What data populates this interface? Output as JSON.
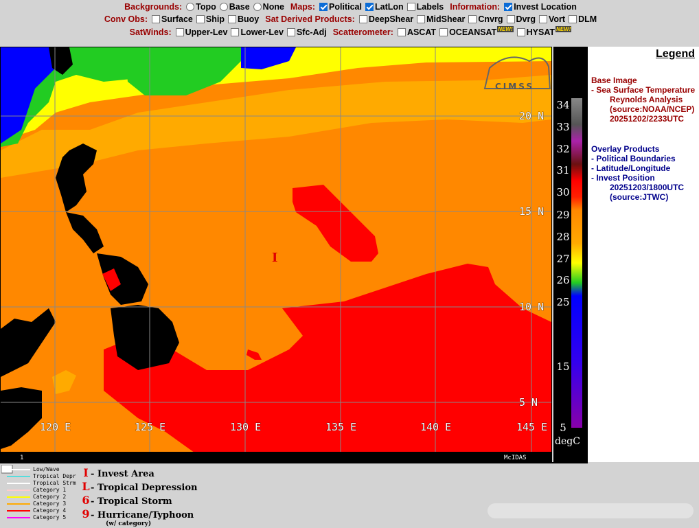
{
  "controls": {
    "backgrounds": {
      "label": "Backgrounds:",
      "options": [
        {
          "label": "Topo",
          "checked": false
        },
        {
          "label": "Base",
          "checked": false
        },
        {
          "label": "None",
          "checked": false
        }
      ]
    },
    "maps": {
      "label": "Maps:",
      "options": [
        {
          "label": "Political",
          "checked": true
        },
        {
          "label": "LatLon",
          "checked": true
        },
        {
          "label": "Labels",
          "checked": false
        }
      ]
    },
    "information": {
      "label": "Information:",
      "options": [
        {
          "label": "Invest Location",
          "checked": true
        }
      ]
    },
    "conv_obs": {
      "label": "Conv Obs:",
      "options": [
        {
          "label": "Surface",
          "checked": false
        },
        {
          "label": "Ship",
          "checked": false
        },
        {
          "label": "Buoy",
          "checked": false
        }
      ]
    },
    "sat_derived": {
      "label": "Sat Derived Products:",
      "options": [
        {
          "label": "DeepShear",
          "checked": false
        },
        {
          "label": "MidShear",
          "checked": false
        },
        {
          "label": "Cnvrg",
          "checked": false
        },
        {
          "label": "Dvrg",
          "checked": false
        },
        {
          "label": "Vort",
          "checked": false
        },
        {
          "label": "DLM",
          "checked": false
        }
      ]
    },
    "satwinds": {
      "label": "SatWinds:",
      "options": [
        {
          "label": "Upper-Lev",
          "checked": false
        },
        {
          "label": "Lower-Lev",
          "checked": false
        },
        {
          "label": "Sfc-Adj",
          "checked": false
        }
      ]
    },
    "scatterometer": {
      "label": "Scatterometer:",
      "options": [
        {
          "label": "ASCAT",
          "checked": false,
          "new": ""
        },
        {
          "label": "OCEANSAT",
          "checked": false,
          "new": "NEW!"
        },
        {
          "label": "HYSAT",
          "checked": false,
          "new": "NEW!"
        }
      ]
    }
  },
  "map": {
    "logo_text": "CIMSS",
    "footer_left": "1",
    "footer_right": "McIDAS",
    "invest_marker": "I",
    "lat_labels": [
      "20 N",
      "15 N",
      "10 N",
      "5 N"
    ],
    "lon_labels": [
      "120 E",
      "125 E",
      "130 E",
      "135 E",
      "140 E",
      "145 E"
    ],
    "sst_colors": {
      "green": "#22cc22",
      "yellow": "#ffff00",
      "light_orange": "#ffaa00",
      "orange": "#ff8800",
      "red": "#ff0000",
      "dark_red": "#aa1111",
      "blue": "#0000ff",
      "land": "#000000"
    }
  },
  "colorbar": {
    "labels": [
      "34",
      "33",
      "32",
      "31",
      "30",
      "29",
      "28",
      "27",
      "26",
      "25",
      "15",
      "5"
    ],
    "unit": "degC"
  },
  "legend": {
    "title": "Legend",
    "base_image_heading": "Base Image",
    "base_image_item": "- Sea Surface Temperature",
    "base_image_sub": [
      "Reynolds Analysis",
      "(source:NOAA/NCEP)",
      "20251202/2233UTC"
    ],
    "overlay_heading": "Overlay Products",
    "overlay_items": [
      "- Political Boundaries",
      "- Latitude/Longitude",
      "- Invest Position"
    ],
    "overlay_sub": [
      "20251203/1800UTC",
      "(source:JTWC)"
    ]
  },
  "storm_legend": {
    "categories": [
      {
        "label": "Low/Wave",
        "color": "#ffffff"
      },
      {
        "label": "Tropical Depr",
        "color": "#55dddd"
      },
      {
        "label": "Tropical Strm",
        "color": "#ffffff"
      },
      {
        "label": "Category 1",
        "color": "#ffcccc"
      },
      {
        "label": "Category 2",
        "color": "#ffff00"
      },
      {
        "label": "Category 3",
        "color": "#ffaa00"
      },
      {
        "label": "Category 4",
        "color": "#ff0000"
      },
      {
        "label": "Category 5",
        "color": "#ff00ff"
      }
    ],
    "symbols": [
      {
        "symbol": "I",
        "label": "- Invest Area"
      },
      {
        "symbol": "L",
        "label": "- Tropical Depression"
      },
      {
        "symbol": "6",
        "label": "- Tropical Storm"
      },
      {
        "symbol": "9",
        "label": "- Hurricane/Typhoon"
      }
    ],
    "note": "(w/ category)"
  }
}
